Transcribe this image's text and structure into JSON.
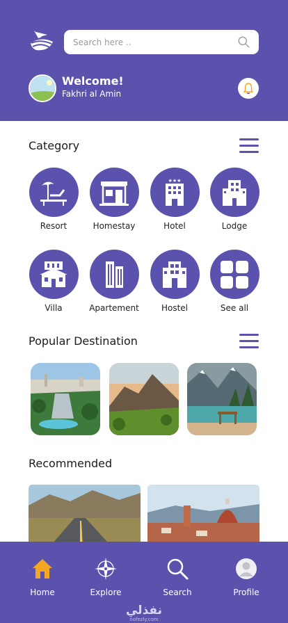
{
  "header": {
    "search": {
      "placeholder": "Search here ..",
      "value": ""
    },
    "welcome": "Welcome!",
    "user_name": "Fakhri al Amin",
    "bg_color": "#5b52ae"
  },
  "category": {
    "title": "Category",
    "items": [
      {
        "label": "Resort",
        "icon": "resort-icon"
      },
      {
        "label": "Homestay",
        "icon": "homestay-icon"
      },
      {
        "label": "Hotel",
        "icon": "hotel-icon"
      },
      {
        "label": "Lodge",
        "icon": "lodge-icon"
      },
      {
        "label": "Villa",
        "icon": "villa-icon"
      },
      {
        "label": "Apartement",
        "icon": "apartment-icon"
      },
      {
        "label": "Hostel",
        "icon": "hostel-icon"
      },
      {
        "label": "See all",
        "icon": "grid-icon"
      }
    ]
  },
  "popular": {
    "title": "Popular Destination",
    "items": [
      {
        "image": "city-waterfall-image"
      },
      {
        "image": "mountain-valley-image"
      },
      {
        "image": "lake-mountains-image"
      }
    ]
  },
  "recommended": {
    "title": "Recommended",
    "items": [
      {
        "image": "desert-road-image"
      },
      {
        "image": "florence-city-image"
      }
    ]
  },
  "nav": {
    "items": [
      {
        "label": "Home",
        "icon": "home-icon",
        "active": true
      },
      {
        "label": "Explore",
        "icon": "compass-icon",
        "active": false
      },
      {
        "label": "Search",
        "icon": "search-icon",
        "active": false
      },
      {
        "label": "Profile",
        "icon": "profile-icon",
        "active": false
      }
    ],
    "active_color": "#f5a623"
  },
  "watermark": {
    "main": "نفذلي",
    "sub": "nofezly.com"
  }
}
